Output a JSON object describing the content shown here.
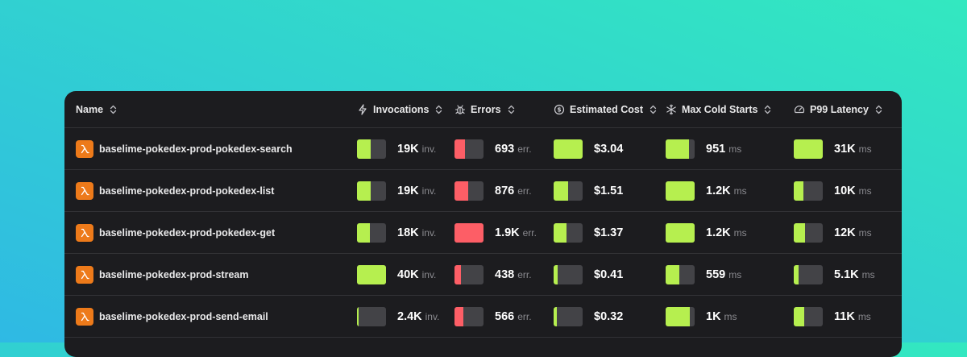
{
  "columns": {
    "name": "Name",
    "invocations": "Invocations",
    "errors": "Errors",
    "cost": "Estimated Cost",
    "cold_starts": "Max Cold Starts",
    "latency": "P99 Latency"
  },
  "colors": {
    "green": "#b6ef4f",
    "red": "#fd5e66",
    "track": "#434347",
    "lambda": "#ed7a1a"
  },
  "rows": [
    {
      "name": "baselime-pokedex-prod-pokedex-search",
      "invocations": {
        "value": "19K",
        "unit": "inv.",
        "level": 0.47
      },
      "errors": {
        "value": "693",
        "unit": "err.",
        "level": 0.36
      },
      "cost": {
        "value": "$3.04",
        "level": 1.0
      },
      "cold_starts": {
        "value": "951",
        "unit": "ms",
        "level": 0.8
      },
      "latency": {
        "value": "31K",
        "unit": "ms",
        "level": 1.0
      }
    },
    {
      "name": "baselime-pokedex-prod-pokedex-list",
      "invocations": {
        "value": "19K",
        "unit": "inv.",
        "level": 0.47
      },
      "errors": {
        "value": "876",
        "unit": "err.",
        "level": 0.47
      },
      "cost": {
        "value": "$1.51",
        "level": 0.5
      },
      "cold_starts": {
        "value": "1.2K",
        "unit": "ms",
        "level": 1.0
      },
      "latency": {
        "value": "10K",
        "unit": "ms",
        "level": 0.33
      }
    },
    {
      "name": "baselime-pokedex-prod-pokedex-get",
      "invocations": {
        "value": "18K",
        "unit": "inv.",
        "level": 0.45
      },
      "errors": {
        "value": "1.9K",
        "unit": "err.",
        "level": 1.0
      },
      "cost": {
        "value": "$1.37",
        "level": 0.45
      },
      "cold_starts": {
        "value": "1.2K",
        "unit": "ms",
        "level": 1.0
      },
      "latency": {
        "value": "12K",
        "unit": "ms",
        "level": 0.39
      }
    },
    {
      "name": "baselime-pokedex-prod-stream",
      "invocations": {
        "value": "40K",
        "unit": "inv.",
        "level": 1.0
      },
      "errors": {
        "value": "438",
        "unit": "err.",
        "level": 0.23
      },
      "cost": {
        "value": "$0.41",
        "level": 0.14
      },
      "cold_starts": {
        "value": "559",
        "unit": "ms",
        "level": 0.47
      },
      "latency": {
        "value": "5.1K",
        "unit": "ms",
        "level": 0.17
      }
    },
    {
      "name": "baselime-pokedex-prod-send-email",
      "invocations": {
        "value": "2.4K",
        "unit": "inv.",
        "level": 0.06
      },
      "errors": {
        "value": "566",
        "unit": "err.",
        "level": 0.3
      },
      "cost": {
        "value": "$0.32",
        "level": 0.11
      },
      "cold_starts": {
        "value": "1K",
        "unit": "ms",
        "level": 0.83
      },
      "latency": {
        "value": "11K",
        "unit": "ms",
        "level": 0.35
      }
    }
  ]
}
